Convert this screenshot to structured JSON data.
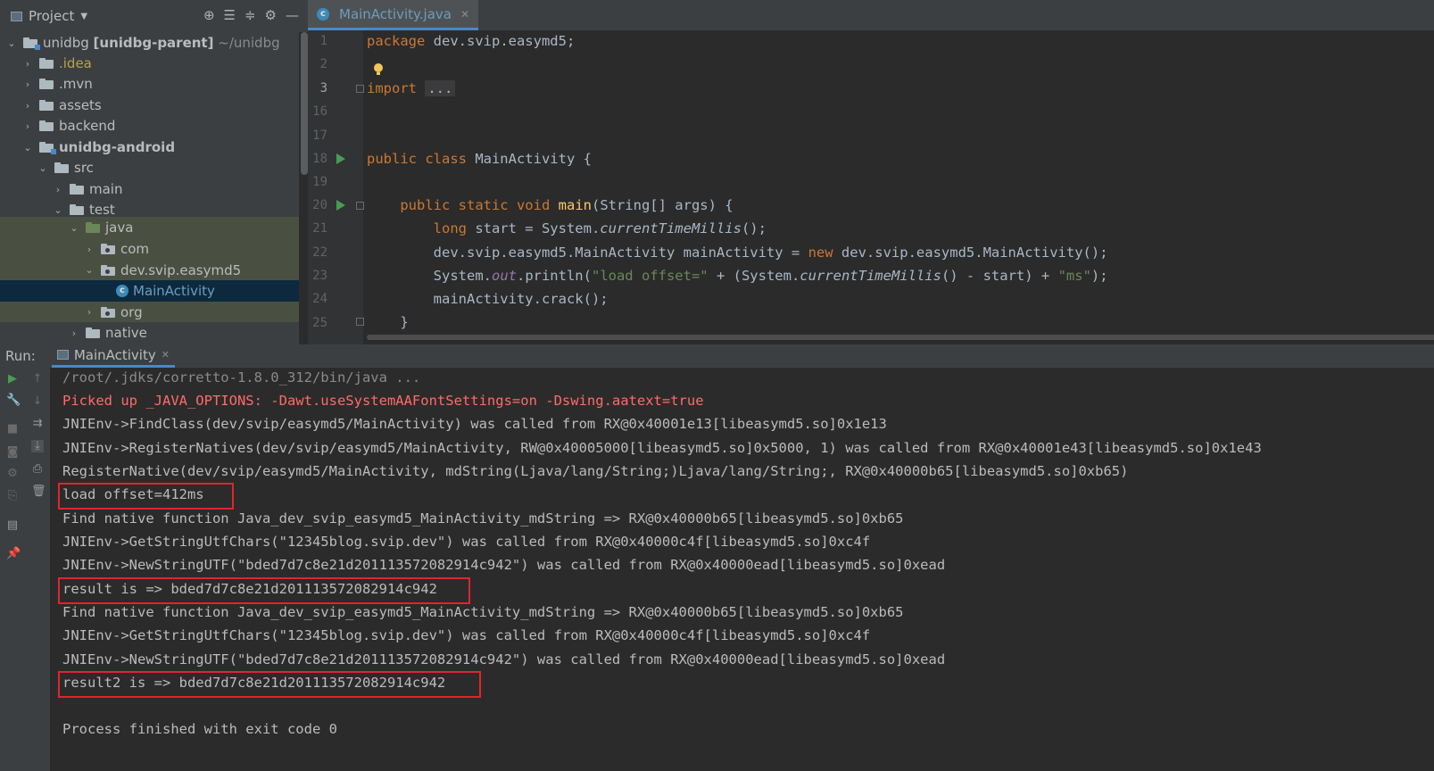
{
  "project_panel": {
    "title": "Project",
    "tree": [
      {
        "name": "unidbg",
        "suffix": "[unidbg-parent]",
        "path": "~/unidbg"
      },
      {
        "name": ".idea"
      },
      {
        "name": ".mvn"
      },
      {
        "name": "assets"
      },
      {
        "name": "backend"
      },
      {
        "name": "unidbg-android"
      },
      {
        "name": "src"
      },
      {
        "name": "main"
      },
      {
        "name": "test"
      },
      {
        "name": "java"
      },
      {
        "name": "com"
      },
      {
        "name": "dev.svip.easymd5"
      },
      {
        "name": "MainActivity"
      },
      {
        "name": "org"
      },
      {
        "name": "native"
      }
    ]
  },
  "editor": {
    "tab_label": "MainActivity.java",
    "line_numbers": [
      "1",
      "2",
      "3",
      "16",
      "17",
      "18",
      "19",
      "20",
      "21",
      "22",
      "23",
      "24",
      "25"
    ]
  },
  "run_panel": {
    "label": "Run:",
    "tab_label": "MainActivity",
    "console": [
      "/root/.jdks/corretto-1.8.0_312/bin/java ...",
      "Picked up _JAVA_OPTIONS: -Dawt.useSystemAAFontSettings=on -Dswing.aatext=true",
      "JNIEnv->FindClass(dev/svip/easymd5/MainActivity) was called from RX@0x40001e13[libeasymd5.so]0x1e13",
      "JNIEnv->RegisterNatives(dev/svip/easymd5/MainActivity, RW@0x40005000[libeasymd5.so]0x5000, 1) was called from RX@0x40001e43[libeasymd5.so]0x1e43",
      "RegisterNative(dev/svip/easymd5/MainActivity, mdString(Ljava/lang/String;)Ljava/lang/String;, RX@0x40000b65[libeasymd5.so]0xb65)",
      "load offset=412ms",
      "Find native function Java_dev_svip_easymd5_MainActivity_mdString => RX@0x40000b65[libeasymd5.so]0xb65",
      "JNIEnv->GetStringUtfChars(\"12345blog.svip.dev\") was called from RX@0x40000c4f[libeasymd5.so]0xc4f",
      "JNIEnv->NewStringUTF(\"bded7d7c8e21d201113572082914c942\") was called from RX@0x40000ead[libeasymd5.so]0xead",
      "result is => bded7d7c8e21d201113572082914c942",
      "Find native function Java_dev_svip_easymd5_MainActivity_mdString => RX@0x40000b65[libeasymd5.so]0xb65",
      "JNIEnv->GetStringUtfChars(\"12345blog.svip.dev\") was called from RX@0x40000c4f[libeasymd5.so]0xc4f",
      "JNIEnv->NewStringUTF(\"bded7d7c8e21d201113572082914c942\") was called from RX@0x40000ead[libeasymd5.so]0xead",
      "result2 is => bded7d7c8e21d201113572082914c942",
      "",
      "Process finished with exit code 0"
    ]
  },
  "colors": {
    "keyword": "#cc7832",
    "string": "#6a8759",
    "function": "#ffc66d",
    "highlight_box": "#e0252b",
    "error_text": "#ff6b68"
  }
}
